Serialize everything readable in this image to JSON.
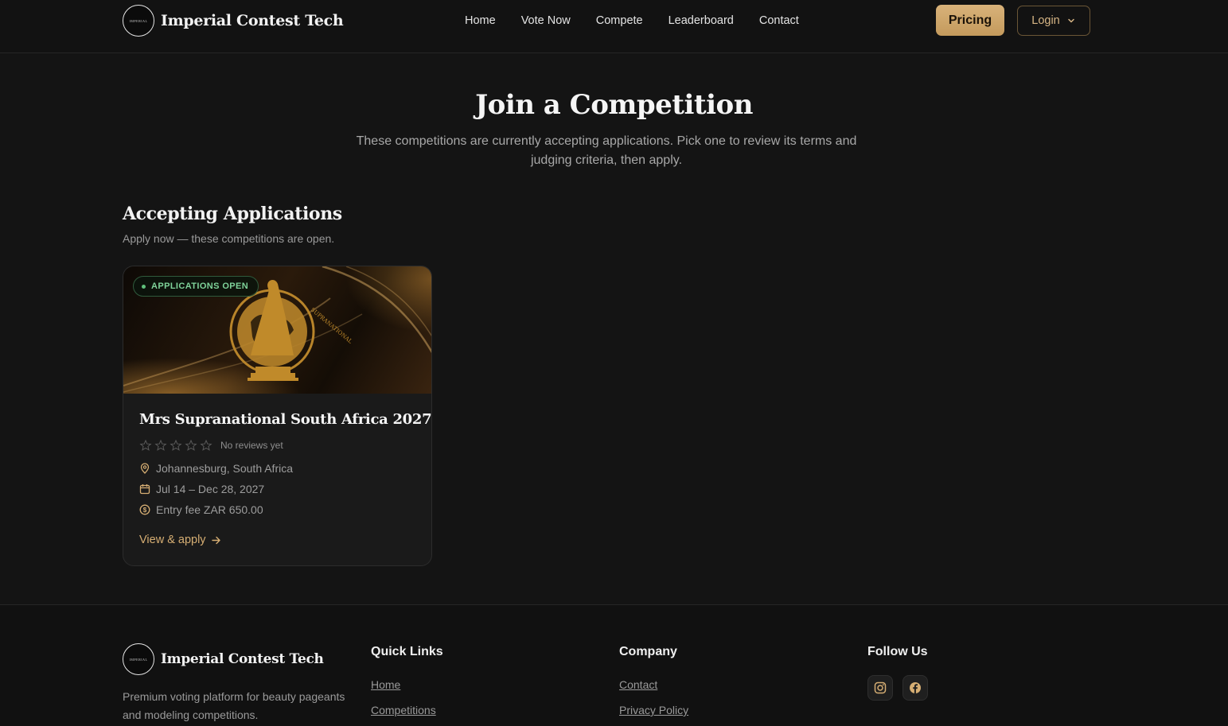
{
  "brand": {
    "name": "Imperial Contest Tech",
    "logo_text": "IMPERIAL"
  },
  "nav": [
    "Home",
    "Vote Now",
    "Compete",
    "Leaderboard",
    "Contact"
  ],
  "header": {
    "pricing_label": "Pricing",
    "login_label": "Login"
  },
  "hero": {
    "title": "Join a Competition",
    "subtitle": "These competitions are currently accepting applications. Pick one to review its terms and judging criteria, then apply."
  },
  "section": {
    "title": "Accepting Applications",
    "subtitle": "Apply now — these competitions are open."
  },
  "card": {
    "badge": "APPLICATIONS OPEN",
    "title": "Mrs Supranational South Africa 2027",
    "rating": 0,
    "reviews": "No reviews yet",
    "location": "Johannesburg, South Africa",
    "dates": "Jul 14 – Dec 28, 2027",
    "fee": "Entry fee ZAR 650.00",
    "cta": "View & apply"
  },
  "footer": {
    "brand_name": "Imperial Contest Tech",
    "description": "Premium voting platform for beauty pageants and modeling competitions.",
    "quick_links": {
      "title": "Quick Links",
      "items": [
        "Home",
        "Competitions"
      ]
    },
    "company": {
      "title": "Company",
      "items": [
        "Contact",
        "Privacy Policy"
      ]
    },
    "follow": {
      "title": "Follow Us",
      "icons": [
        "instagram-icon",
        "facebook-icon"
      ]
    }
  },
  "colors": {
    "accent": "#d6ae73",
    "pricing_bg": "#cfa86c",
    "badge_green": "#7fd39a",
    "background": "#141414"
  }
}
